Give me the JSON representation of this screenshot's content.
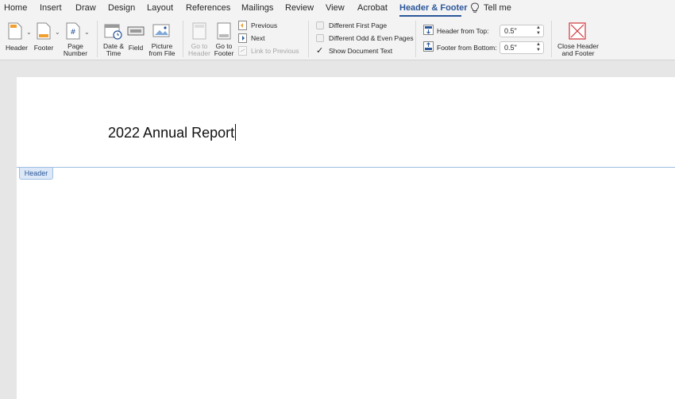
{
  "tabs": [
    {
      "label": "Home"
    },
    {
      "label": "Insert"
    },
    {
      "label": "Draw"
    },
    {
      "label": "Design"
    },
    {
      "label": "Layout"
    },
    {
      "label": "References"
    },
    {
      "label": "Mailings"
    },
    {
      "label": "Review"
    },
    {
      "label": "View"
    },
    {
      "label": "Acrobat"
    },
    {
      "label": "Header & Footer",
      "active": true
    },
    {
      "label": "Tell me"
    }
  ],
  "ribbon": {
    "header": {
      "label": "Header"
    },
    "footer": {
      "label": "Footer"
    },
    "page_number": {
      "label1": "Page",
      "label2": "Number"
    },
    "date_time": {
      "label1": "Date &",
      "label2": "Time"
    },
    "field": {
      "label": "Field"
    },
    "picture": {
      "label1": "Picture",
      "label2": "from File"
    },
    "go_header": {
      "label1": "Go to",
      "label2": "Header"
    },
    "go_footer": {
      "label1": "Go to",
      "label2": "Footer"
    },
    "previous": {
      "label": "Previous"
    },
    "next": {
      "label": "Next"
    },
    "link_previous": {
      "label": "Link to Previous"
    },
    "options": {
      "different_first": {
        "label": "Different First Page",
        "checked": false
      },
      "different_odd_even": {
        "label": "Different Odd & Even Pages",
        "checked": false
      },
      "show_doc_text": {
        "label": "Show Document Text",
        "checked": true
      }
    },
    "header_from_top": {
      "label": "Header from Top:",
      "value": "0.5\""
    },
    "footer_from_bottom": {
      "label": "Footer from Bottom:",
      "value": "0.5\""
    },
    "close": {
      "label1": "Close Header",
      "label2": "and Footer"
    }
  },
  "document": {
    "header_text": "2022 Annual Report",
    "header_tag": "Header"
  },
  "colors": {
    "accent": "#2b579a",
    "close_red": "#d13438"
  }
}
